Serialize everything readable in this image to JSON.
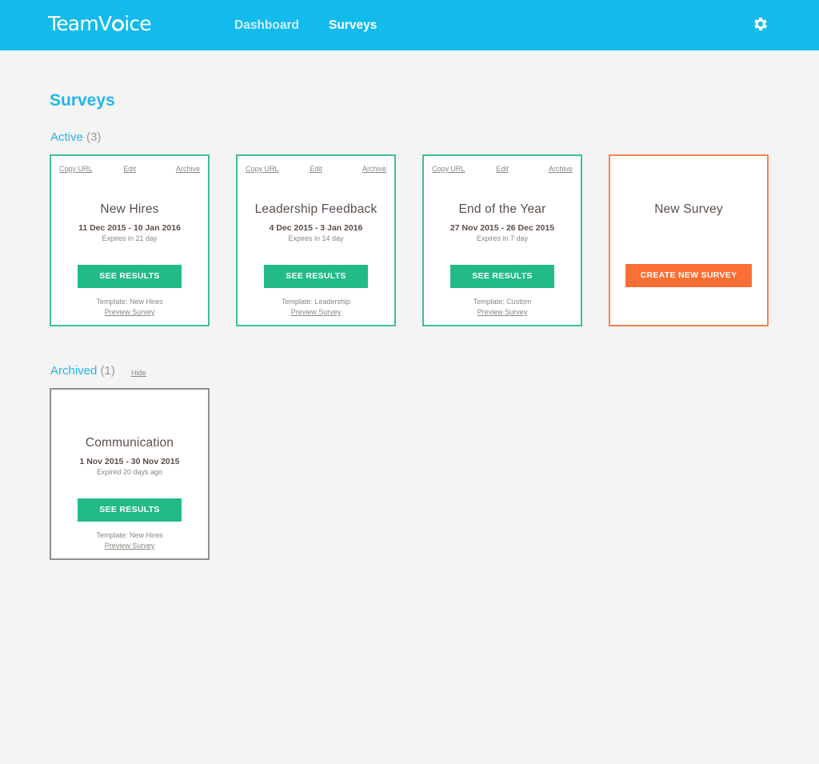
{
  "app": {
    "logo": {
      "before": "TeamV",
      "after": "ice"
    },
    "nav": [
      {
        "label": "Dashboard",
        "active": false
      },
      {
        "label": "Surveys",
        "active": true
      }
    ],
    "settings_icon": "gear-icon",
    "brand_color": "#12bbec"
  },
  "page": {
    "title": "Surveys"
  },
  "active_section": {
    "label": "Active",
    "count": "(3)",
    "cards": [
      {
        "actions": {
          "copy": "Copy URL",
          "edit": "Edit",
          "archive": "Archive"
        },
        "title": "New Hires",
        "dates": "11 Dec 2015 - 10 Jan 2016",
        "expires": "Expires in 21 day",
        "button": "SEE RESULTS",
        "template": "Template: New Hires",
        "preview": "Preview Survey"
      },
      {
        "actions": {
          "copy": "Copy URL",
          "edit": "Edit",
          "archive": "Archive"
        },
        "title": "Leadership Feedback",
        "dates": "4 Dec 2015 - 3 Jan 2016",
        "expires": "Expires in 14 day",
        "button": "SEE RESULTS",
        "template": "Template: Leadership",
        "preview": "Preview Survey"
      },
      {
        "actions": {
          "copy": "Copy URL",
          "edit": "Edit",
          "archive": "Archive"
        },
        "title": "End of the Year",
        "dates": "27 Nov 2015 - 26 Dec 2015",
        "expires": "Expires in 7 day",
        "button": "SEE RESULTS",
        "template": "Template: Custom",
        "preview": "Preview Survey"
      }
    ],
    "new_card": {
      "title": "New Survey",
      "button": "CREATE NEW SURVEY"
    }
  },
  "archived_section": {
    "label": "Archived",
    "count": "(1)",
    "hide_label": "Hide",
    "cards": [
      {
        "title": "Communication",
        "dates": "1 Nov 2015 - 30 Nov 2015",
        "expires": "Expired 20 days ago",
        "button": "SEE RESULTS",
        "template": "Template: New Hires",
        "preview": "Preview Survey"
      }
    ]
  },
  "colors": {
    "active_border": "#3cc193",
    "new_border": "#f5834f",
    "archived_border": "#8e8e8e",
    "results_button": "#22bb88",
    "create_button": "#fb6f34",
    "heading": "#22b5e9"
  }
}
